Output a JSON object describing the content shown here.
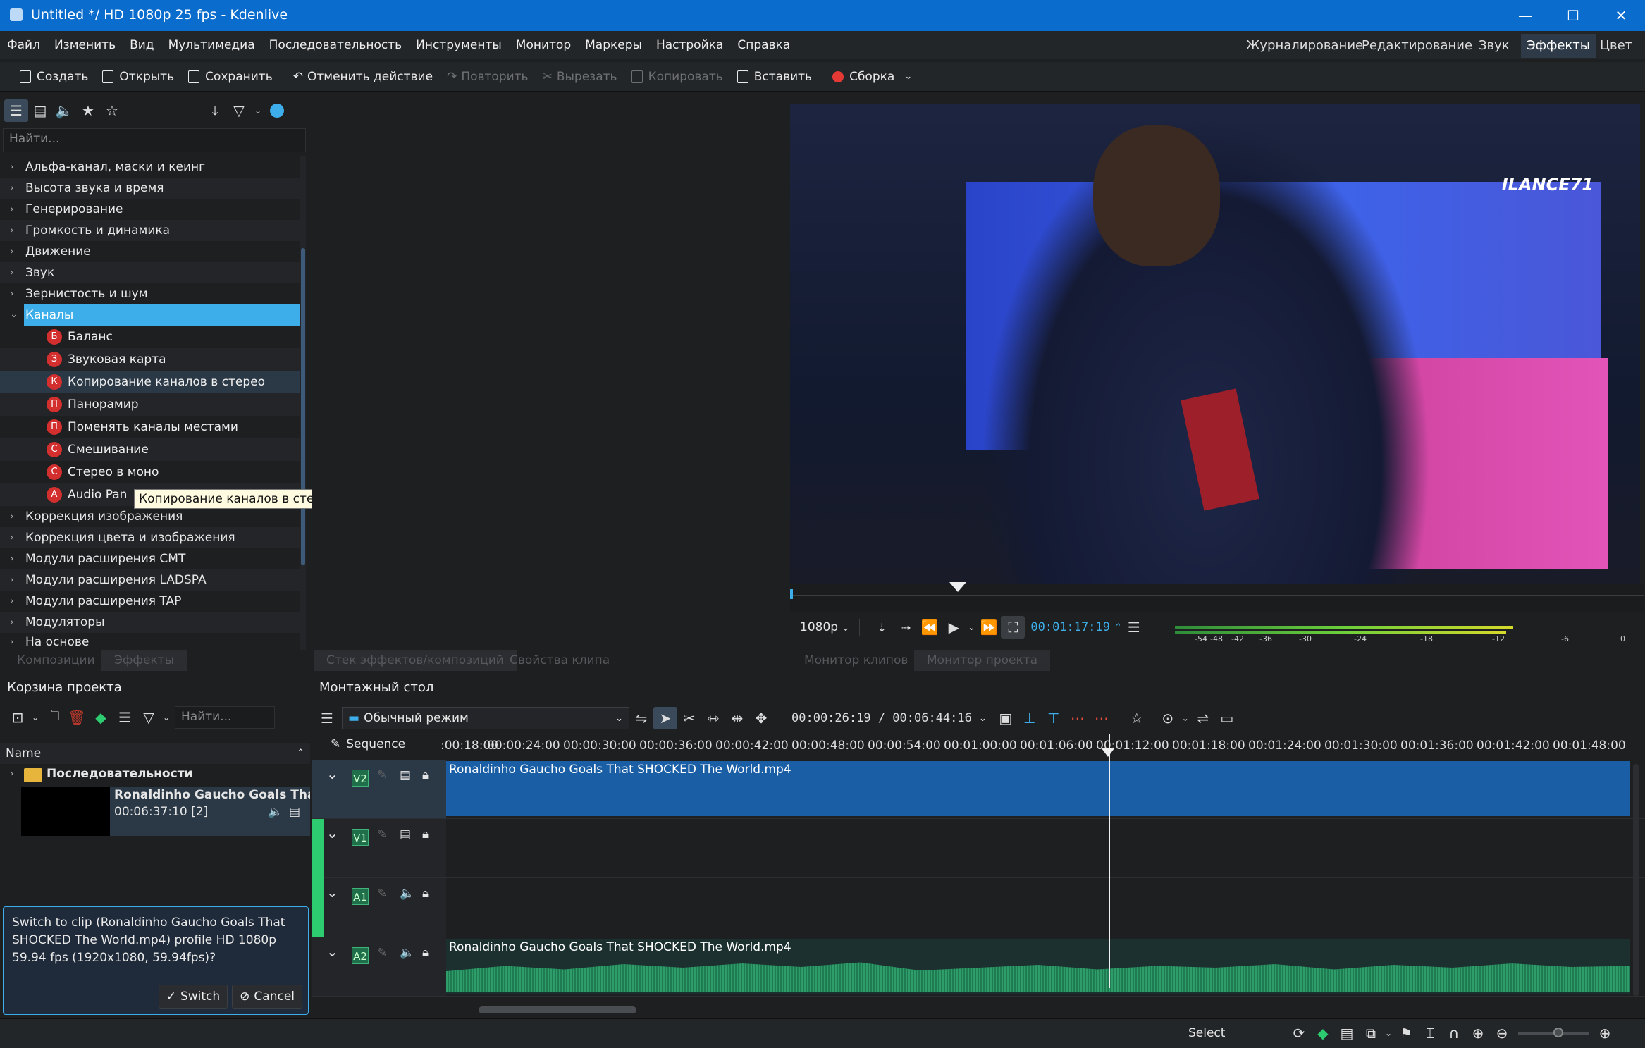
{
  "window": {
    "title": "Untitled */ HD 1080p 25 fps - Kdenlive",
    "minimize": "—",
    "maximize": "☐",
    "close": "✕"
  },
  "menu": [
    "Файл",
    "Изменить",
    "Вид",
    "Мультимедиа",
    "Последовательность",
    "Инструменты",
    "Монитор",
    "Маркеры",
    "Настройка",
    "Справка"
  ],
  "workspaces": [
    "Журналирование",
    "Редактирование",
    "Звук",
    "Эффекты",
    "Цвет"
  ],
  "toolbar": {
    "create": "Создать",
    "open": "Открыть",
    "save": "Сохранить",
    "undo": "Отменить действие",
    "redo": "Повторить",
    "cut": "Вырезать",
    "copy": "Копировать",
    "paste": "Вставить",
    "build": "Сборка"
  },
  "effects": {
    "search_placeholder": "Найти...",
    "categories_top": [
      "Альфа-канал, маски и кеинг",
      "Высота звука и время",
      "Генерирование",
      "Громкость и динамика",
      "Движение",
      "Звук",
      "Зернистость и шум"
    ],
    "open_category": "Каналы",
    "children": [
      {
        "badge": "Б",
        "label": "Баланс"
      },
      {
        "badge": "З",
        "label": "Звуковая карта"
      },
      {
        "badge": "К",
        "label": "Копирование каналов в стерео"
      },
      {
        "badge": "П",
        "label": "Панорамир"
      },
      {
        "badge": "П",
        "label": "Поменять каналы местами"
      },
      {
        "badge": "С",
        "label": "Смешивание"
      },
      {
        "badge": "С",
        "label": "Стерео в моно"
      },
      {
        "badge": "A",
        "label": "Audio Pan"
      }
    ],
    "categories_bottom": [
      "Коррекция изображения",
      "Коррекция цвета и изображения",
      "Модули расширения CMT",
      "Модули расширения LADSPA",
      "Модули расширения TAP",
      "Модуляторы",
      "На основе"
    ],
    "tooltip": "Копирование каналов в стерео",
    "tabs": [
      "Композиции",
      "Эффекты"
    ]
  },
  "stack_tabs": [
    "Стек эффектов/композиций",
    "Свойства клипа"
  ],
  "monitor": {
    "logo": "ILANCE71",
    "resolution": "1080p",
    "timecode": "00:01:17:19",
    "vu_labels": [
      "-54",
      "-48",
      "-42",
      "-36",
      "-30",
      "-24",
      "-18",
      "-12",
      "-6",
      "0"
    ],
    "tabs": [
      "Монитор клипов",
      "Монитор проекта"
    ]
  },
  "bin": {
    "title": "Корзина проекта",
    "search_placeholder": "Найти...",
    "column_name": "Name",
    "folder": "Последовательности",
    "clip_name": "Ronaldinho Gaucho Goals That S",
    "clip_info": "00:06:37:10 [2]",
    "switch_text": "Switch to clip (Ronaldinho Gaucho Goals That SHOCKED The World.mp4) profile HD 1080p 59.94 fps (1920x1080, 59.94fps)?",
    "switch_btn": "Switch",
    "cancel_btn": "Cancel"
  },
  "timeline": {
    "title": "Монтажный стол",
    "mode": "Обычный режим",
    "timecode": "00:00:26:19 / 00:06:44:16",
    "sequence": "Sequence",
    "ruler": [
      ":00:18:00",
      "00:00:24:00",
      "00:00:30:00",
      "00:00:36:00",
      "00:00:42:00",
      "00:00:48:00",
      "00:00:54:00",
      "00:01:00:00",
      "00:01:06:00",
      "00:01:12:00",
      "00:01:18:00",
      "00:01:24:00",
      "00:01:30:00",
      "00:01:36:00",
      "00:01:42:00",
      "00:01:48:00"
    ],
    "tracks": [
      "V2",
      "V1",
      "A1",
      "A2"
    ],
    "video_clip": "Ronaldinho Gaucho Goals That SHOCKED The World.mp4",
    "audio_clip": "Ronaldinho Gaucho Goals That SHOCKED The World.mp4"
  },
  "status": {
    "mode": "Select"
  }
}
